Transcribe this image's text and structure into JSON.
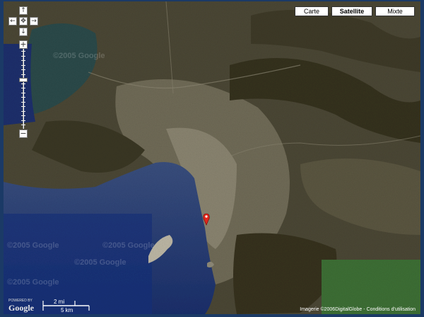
{
  "map_type_buttons": [
    {
      "label": "Carte",
      "active": false
    },
    {
      "label": "Satellite",
      "active": true
    },
    {
      "label": "Mixte",
      "active": false
    }
  ],
  "pan_controls": {
    "up": "↑",
    "left": "←",
    "center": "✥",
    "right": "→",
    "down": "↓"
  },
  "zoom_controls": {
    "in": "+",
    "out": "−",
    "level_fraction": 0.38
  },
  "watermark": "©2005 Google",
  "logo": {
    "powered_by": "POWERED BY",
    "brand": "Google"
  },
  "scale": {
    "top_label": "2 mi",
    "bottom_label": "5 km"
  },
  "copyright": {
    "imagery": "Imagerie ©2006DigitalGlobe",
    "separator": " - ",
    "terms": "Conditions d'utilisation"
  },
  "marker": {
    "icon": "map-marker-icon",
    "color": "#e0261c"
  },
  "colors": {
    "sea": "#1f3a6e",
    "land": "#4b4735",
    "forest": "#2f5a2a",
    "urban": "#7b7664"
  }
}
